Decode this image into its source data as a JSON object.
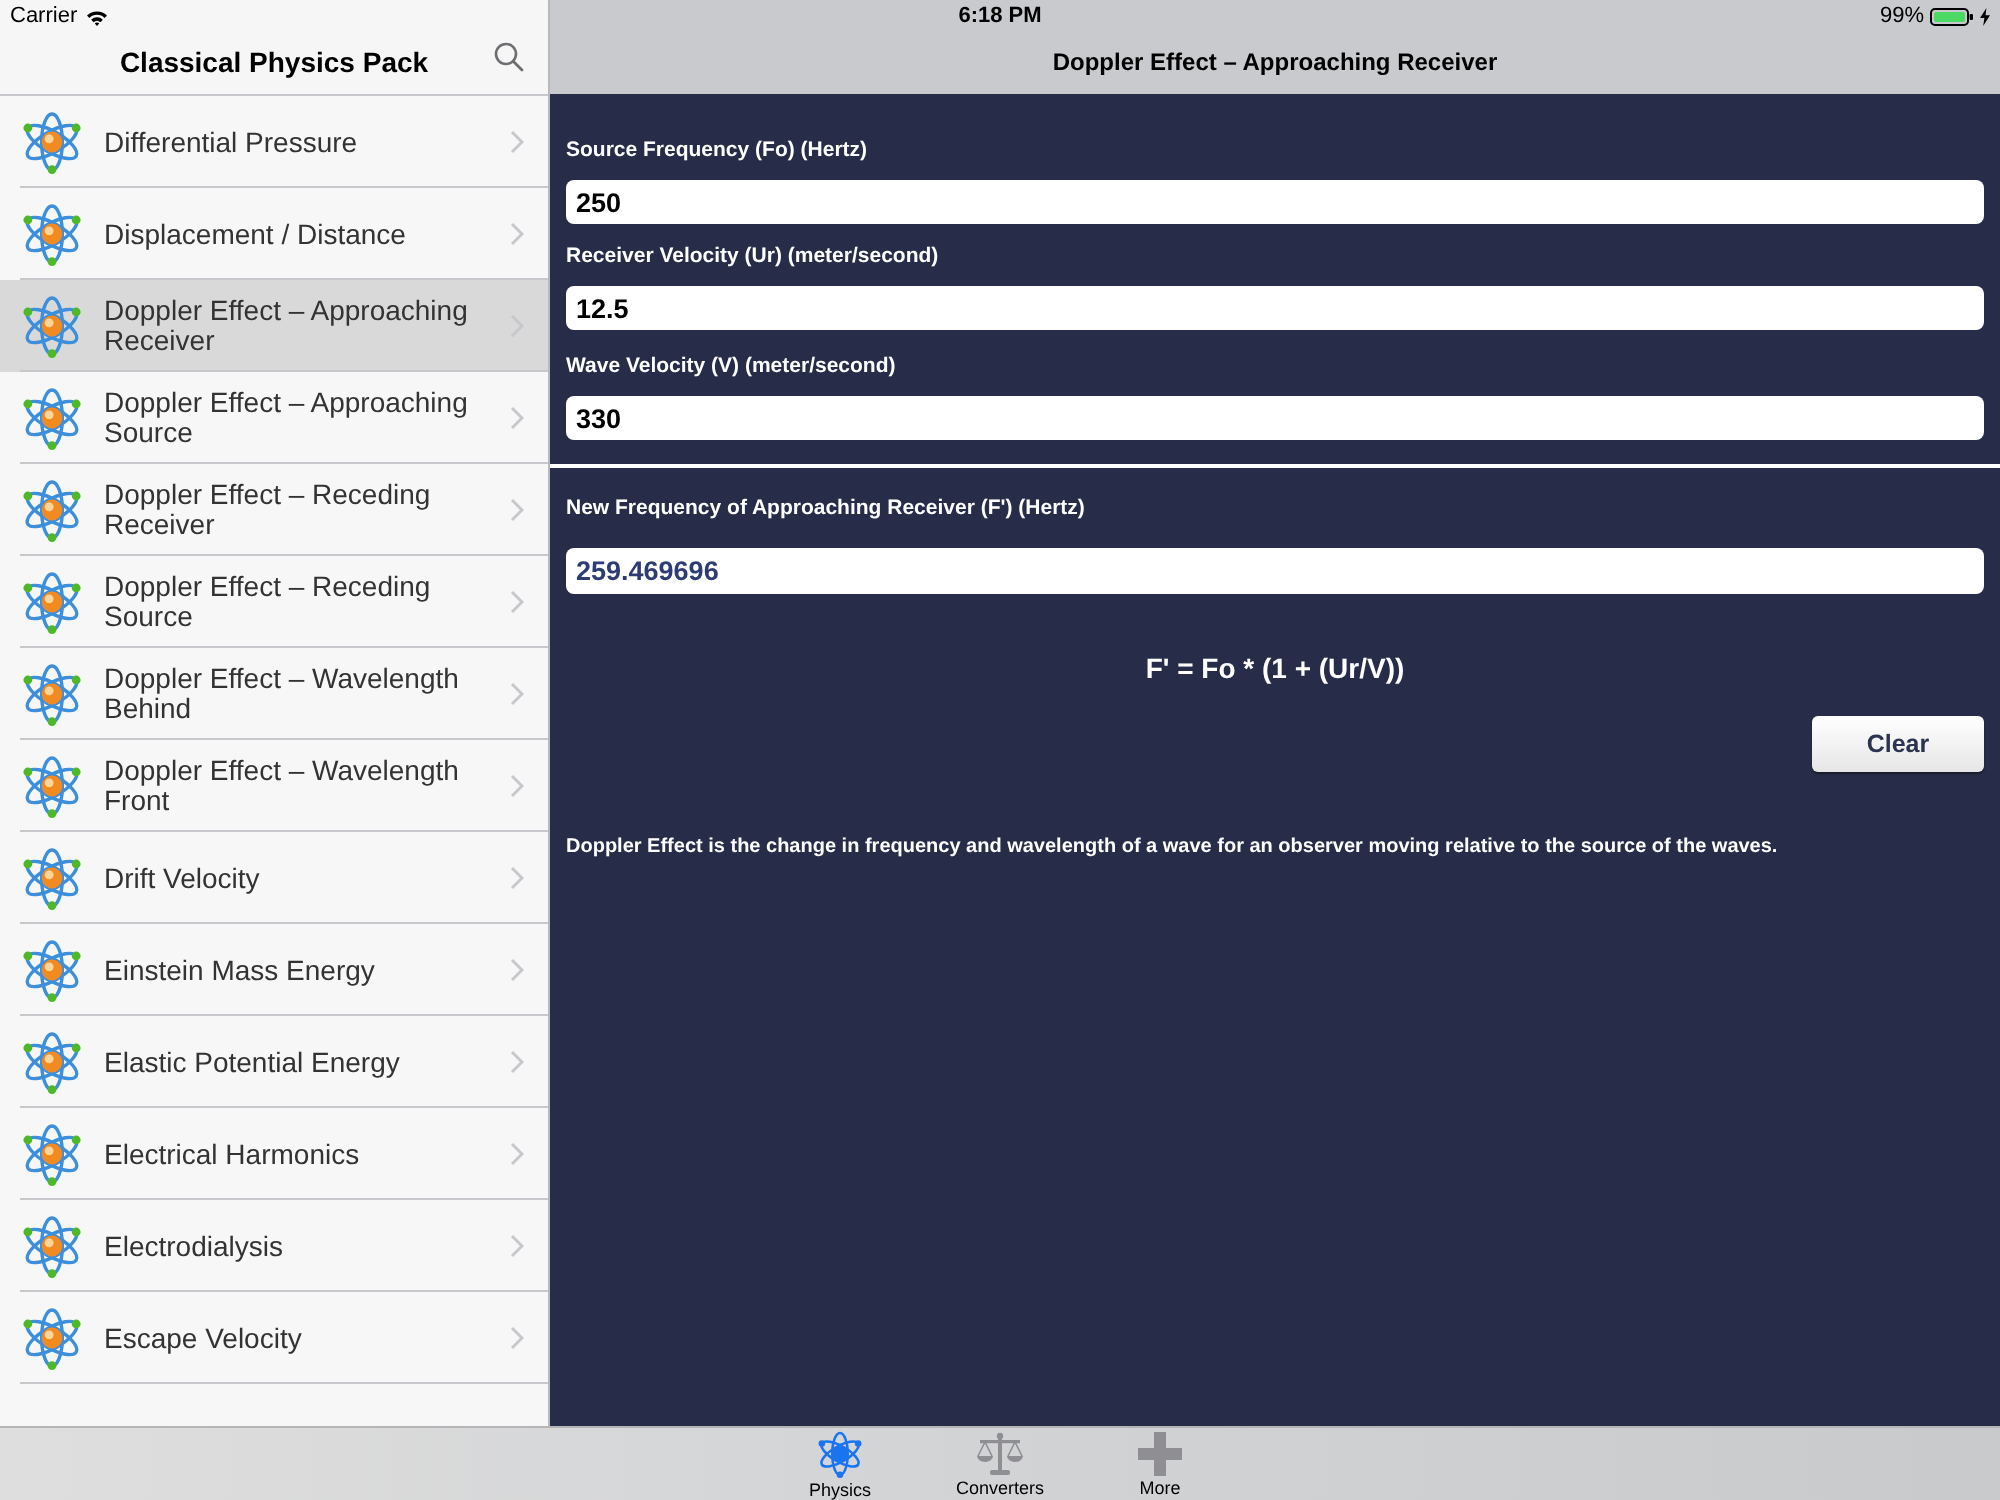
{
  "status_bar": {
    "carrier": "Carrier",
    "time": "6:18 PM",
    "battery": "99%"
  },
  "sidebar": {
    "title": "Classical Physics Pack",
    "items": [
      {
        "label": "Differential Pressure",
        "selected": false
      },
      {
        "label": "Displacement / Distance",
        "selected": false
      },
      {
        "label": "Doppler Effect – Approaching Receiver",
        "selected": true
      },
      {
        "label": "Doppler Effect – Approaching Source",
        "selected": false
      },
      {
        "label": "Doppler Effect – Receding Receiver",
        "selected": false
      },
      {
        "label": "Doppler Effect – Receding Source",
        "selected": false
      },
      {
        "label": "Doppler Effect – Wavelength Behind",
        "selected": false
      },
      {
        "label": "Doppler Effect – Wavelength Front",
        "selected": false
      },
      {
        "label": "Drift Velocity",
        "selected": false
      },
      {
        "label": "Einstein Mass Energy",
        "selected": false
      },
      {
        "label": "Elastic Potential Energy",
        "selected": false
      },
      {
        "label": "Electrical Harmonics",
        "selected": false
      },
      {
        "label": "Electrodialysis",
        "selected": false
      },
      {
        "label": "Escape Velocity",
        "selected": false
      }
    ]
  },
  "detail": {
    "title": "Doppler Effect – Approaching Receiver",
    "inputs": [
      {
        "label": "Source Frequency (Fo) (Hertz)",
        "value": "250"
      },
      {
        "label": "Receiver Velocity (Ur) (meter/second)",
        "value": "12.5"
      },
      {
        "label": "Wave Velocity (V) (meter/second)",
        "value": "330"
      }
    ],
    "result": {
      "label": "New Frequency of Approaching Receiver (F') (Hertz)",
      "value": "259.469696"
    },
    "formula": "F' = Fo * (1 + (Ur/V))",
    "clear_button": "Clear",
    "description": "Doppler Effect is the change in frequency and wavelength of a wave for an observer moving relative to the source of the waves."
  },
  "tab_bar": [
    {
      "label": "Physics",
      "selected": true
    },
    {
      "label": "Converters",
      "selected": false
    },
    {
      "label": "More",
      "selected": false
    }
  ]
}
